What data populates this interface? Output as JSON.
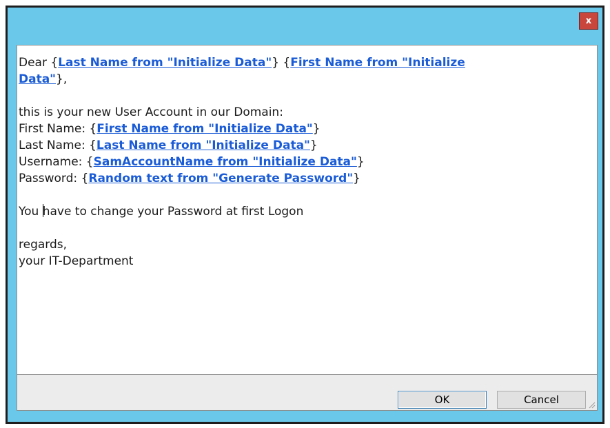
{
  "window": {
    "close_label": "x"
  },
  "message": {
    "line1": [
      {
        "type": "text",
        "value": "Dear {"
      },
      {
        "type": "token",
        "value": "Last Name from \"Initialize Data\""
      },
      {
        "type": "text",
        "value": "} {"
      },
      {
        "type": "token",
        "value": "First Name from \"Initialize "
      }
    ],
    "line2": [
      {
        "type": "token",
        "value": "Data\""
      },
      {
        "type": "text",
        "value": "},"
      }
    ],
    "line_account_intro": "this is your new User Account in our Domain:",
    "first_name": {
      "label": "First Name: {",
      "token": "First Name from \"Initialize Data\"",
      "close": "}"
    },
    "last_name": {
      "label": "Last Name: {",
      "token": "Last Name from \"Initialize Data\"",
      "close": "}"
    },
    "username": {
      "label": "Username: {",
      "token": "SamAccountName from \"Initialize Data\"",
      "close": "}"
    },
    "password": {
      "label": "Password: {",
      "token": "Random text from \"Generate Password\"",
      "close": "}"
    },
    "change_pw_before_caret": "You ",
    "change_pw_after_caret": "have to change your Password at first Logon",
    "regards": "regards,",
    "signature": "your IT-Department"
  },
  "buttons": {
    "ok": "OK",
    "cancel": "Cancel"
  }
}
